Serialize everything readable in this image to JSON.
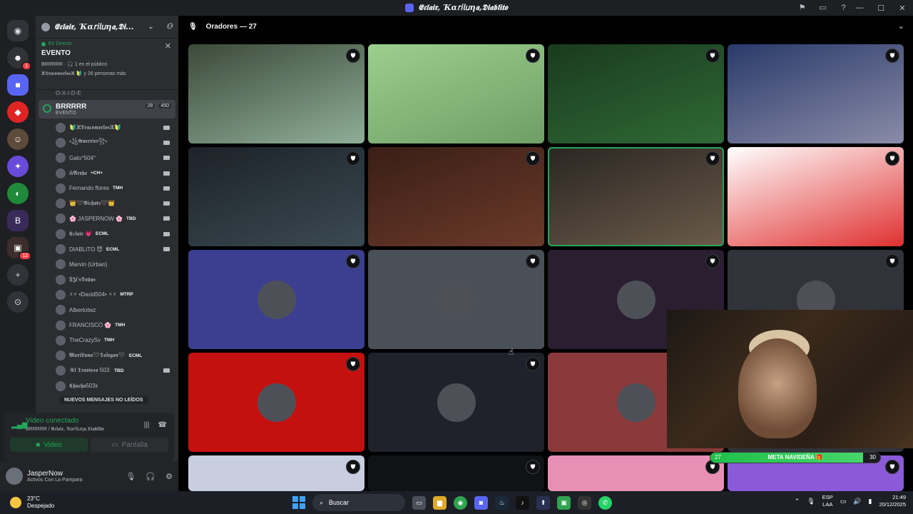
{
  "window": {
    "title": "𝕰𝖈𝖑𝖆𝖎𝖗, Ҡα𝗋𝗂𝗅𝗎η𝖆,𝕯𝖎𝖆𝖇𝖑𝖎𝖙𝖔",
    "controls": [
      "—",
      "☐",
      "✕"
    ],
    "top_icons": [
      "inbox-icon",
      "screen-icon",
      "help-icon"
    ]
  },
  "servers": [
    {
      "name": "discord-home",
      "glyph": "◉",
      "badge": ""
    },
    {
      "name": "server-1",
      "glyph": "☻",
      "badge": "1"
    },
    {
      "name": "server-2",
      "glyph": "■",
      "badge": ""
    },
    {
      "name": "server-3",
      "glyph": "◆",
      "badge": ""
    },
    {
      "name": "server-4",
      "glyph": "☺",
      "badge": ""
    },
    {
      "name": "server-5",
      "glyph": "✦",
      "badge": ""
    },
    {
      "name": "server-6",
      "glyph": "◐",
      "badge": ""
    },
    {
      "name": "server-7",
      "glyph": "B",
      "badge": ""
    },
    {
      "name": "server-8",
      "glyph": "▣",
      "badge": "12"
    },
    {
      "name": "add-server",
      "glyph": "+",
      "badge": ""
    },
    {
      "name": "discover",
      "glyph": "⊙",
      "badge": ""
    }
  ],
  "guild": {
    "name": "𝕰𝖈𝖑𝖆𝖎𝖗, Ҡα𝗋𝗂𝗅𝗎η𝖆,𝕯𝖎...",
    "event_live": "En Directo",
    "event_title": "EVENTO",
    "event_audience": "BRRRRR · 🎧 1 en el público",
    "event_more": "ⵣ𝕯𝖗𝖆𝖈𝖔𝖒𝖊𝖗𝖑𝖔𝖘ⵣ 🔰 y 26 personas más",
    "peek_name": "O-X-I-D-E"
  },
  "stage_channel": {
    "name": "BRRRRR",
    "sub": "EVENTO",
    "count_a": "28",
    "count_b": "450"
  },
  "members": [
    {
      "name": "🔰ⵣ𝕯𝖗𝖆𝖈𝖔𝖒𝖊𝖗𝖑𝖔𝖘ⵣ🔰",
      "tag": "",
      "cam": true
    },
    {
      "name": "꧁𝕲𝖚𝖊𝖗𝖗𝖎𝖊𝖗꧂",
      "tag": "",
      "cam": true
    },
    {
      "name": "Gato°504°",
      "tag": "",
      "cam": true
    },
    {
      "name": "ŵ𝕬𝖗𝖝𝖇𝖊",
      "tag": "+CH+",
      "cam": true
    },
    {
      "name": "Fernando flores",
      "tag": "TMH",
      "cam": true
    },
    {
      "name": "👑🖤𝕭𝖎𝖈𝖍𝖔𝖙𝖘🖤👑",
      "tag": "",
      "cam": true
    },
    {
      "name": "🌸 JASPERNOW 🌸",
      "tag": "TBD",
      "cam": true
    },
    {
      "name": "𝕰𝖈𝖑𝖆𝖎𝖗 💗",
      "tag": "ECML",
      "cam": true
    },
    {
      "name": "DIABLITO 😈",
      "tag": "ECML",
      "cam": true
    },
    {
      "name": "Marvin (Urban)",
      "tag": "",
      "cam": false
    },
    {
      "name": "$𝕵𝖎'𝖘𝕯𝖆𝖇𝖞𝖘",
      "tag": "",
      "cam": false
    },
    {
      "name": "⚡⚡ •David504• ⚡⚡",
      "tag": "MTRP",
      "cam": false
    },
    {
      "name": "Albertotwz",
      "tag": "",
      "cam": false
    },
    {
      "name": "FRANCISCO 🌸",
      "tag": "TMH",
      "cam": false
    },
    {
      "name": "TheCrazySv",
      "tag": "TMH",
      "cam": false
    },
    {
      "name": "𝕸𝖆𝖗𝖎𝕷𝖚𝖓𝖆🖤𝕿𝖆𝖑𝖊𝖌𝖔𝖓🖤",
      "tag": "ECML",
      "cam": false
    },
    {
      "name": "⫶𝕰𝖑 𝕿𝖗𝖆𝖛𝖎𝖊𝖘𝖔 503⫶",
      "tag": "TBD",
      "cam": true
    },
    {
      "name": "𝕮𝖍𝖆𝖈𝖍𝖔503𝖗",
      "tag": "",
      "cam": false
    }
  ],
  "unread_label": "NUEVOS MENSAJES NO LEÍDOS",
  "voice": {
    "status": "Video conectado",
    "sub": "BRRRRR / 𝕰𝖈𝖑𝖆𝖎𝖗, Ҡα𝗋𝗂𝗅𝗎η𝖆,𝕯𝖎𝖆𝖇𝖑𝖎𝖙𝖔",
    "video_label": "Video",
    "screen_label": "Pantalla"
  },
  "user": {
    "name": "JasperNow",
    "status": "Activos Con La Pampara"
  },
  "stage": {
    "header": "Oradores — 27"
  },
  "tiles": [
    {
      "bg": "#3c4a3a",
      "grad": "#8fae98"
    },
    {
      "bg": "#9ccf8e",
      "grad": "#6f9e66"
    },
    {
      "bg": "#1a3a1e",
      "grad": "#2f6a36"
    },
    {
      "bg": "#2a3a6a",
      "grad": "#8a8ca8"
    },
    {
      "bg": "#1c2228",
      "grad": "#3b4a52"
    },
    {
      "bg": "#3a1e16",
      "grad": "#6b3a2a"
    },
    {
      "bg": "#2a2622",
      "grad": "#6a5a4a"
    },
    {
      "bg": "#ffffff",
      "grad": "#e03030"
    },
    {
      "bg": "#3c3f8f",
      "grad": "#3c3f8f"
    },
    {
      "bg": "#4a5058",
      "grad": "#4a5058"
    },
    {
      "bg": "#2a1e30",
      "grad": "#2a1e30"
    },
    {
      "bg": "#31333a",
      "grad": "#31333a"
    },
    {
      "bg": "#c51010",
      "grad": "#c51010"
    },
    {
      "bg": "#1f222a",
      "grad": "#1f222a"
    },
    {
      "bg": "#8a3a3a",
      "grad": "#8a3a3a"
    },
    {
      "bg": "#31333a",
      "grad": "#31333a"
    },
    {
      "bg": "#c8cde0",
      "grad": "#c8cde0"
    },
    {
      "bg": "#111214",
      "grad": "#111214"
    },
    {
      "bg": "#e88fb6",
      "grad": "#e88fb6"
    },
    {
      "bg": "#8a5ad8",
      "grad": "#8a5ad8"
    }
  ],
  "meta_goal": {
    "label": "META NAVIDEÑA 🎁",
    "start": "27",
    "end": "30",
    "progress": 0.9
  },
  "taskbar": {
    "temp": "23°C",
    "weather": "Despejado",
    "search_placeholder": "Buscar",
    "lang_top": "ESP",
    "lang_bottom": "LAA",
    "time": "21:49",
    "date": "20/12/2025"
  },
  "colors": {
    "accent": "#5865f2",
    "online": "#23a55a",
    "background": "#1e1f22"
  }
}
